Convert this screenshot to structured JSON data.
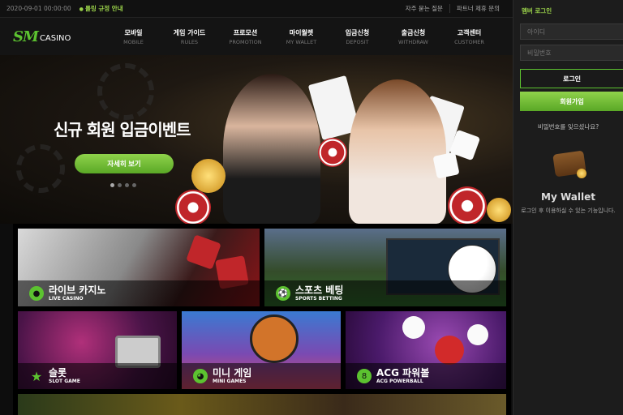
{
  "topbar": {
    "date": "2020-09-01 00:00:00",
    "notice": "롤링 규정 안내",
    "links": [
      "자주 묻는 질문",
      "파트너 제휴 문의"
    ]
  },
  "logo": {
    "mark": "SM",
    "text": "CASINO"
  },
  "nav": [
    {
      "ko": "모바일",
      "en": "MOBILE"
    },
    {
      "ko": "게임 가이드",
      "en": "RULES"
    },
    {
      "ko": "프로모션",
      "en": "PROMOTION"
    },
    {
      "ko": "마이월렛",
      "en": "MY WALLET"
    },
    {
      "ko": "입금신청",
      "en": "DEPOSIT"
    },
    {
      "ko": "출금신청",
      "en": "WITHDRAW"
    },
    {
      "ko": "고객센터",
      "en": "CUSTOMER"
    }
  ],
  "hero": {
    "title": "신규 회원 입금이벤트",
    "button": "자세히 보기",
    "slides": 4,
    "active_slide": 1
  },
  "games": {
    "live": {
      "ko": "라이브 카지노",
      "en": "LIVE CASINO",
      "icon": "chip-icon"
    },
    "sports": {
      "ko": "스포츠 베팅",
      "en": "SPORTS BETTING",
      "icon": "soccer-ball-icon"
    },
    "slot": {
      "ko": "슬롯",
      "en": "SLOT GAME",
      "icon": "star-icon"
    },
    "mini": {
      "ko": "미니 게임",
      "en": "MINI GAMES",
      "icon": "pacman-icon"
    },
    "acg": {
      "ko": "ACG 파워볼",
      "en": "ACG POWERBALL",
      "icon": "powerball-icon"
    }
  },
  "sidebar": {
    "title": "멤버 로그인",
    "id_placeholder": "아이디",
    "pw_placeholder": "비밀번호",
    "login": "로그인",
    "join": "회원가입",
    "forgot": "비밀번호를 잊으셨나요?",
    "wallet_title": "My Wallet",
    "wallet_desc": "로그인 후 이용하실 수 있는 기능입니다."
  },
  "colors": {
    "accent": "#5cc230",
    "accent_text": "#9bd34a",
    "background": "#0d0d0d"
  }
}
